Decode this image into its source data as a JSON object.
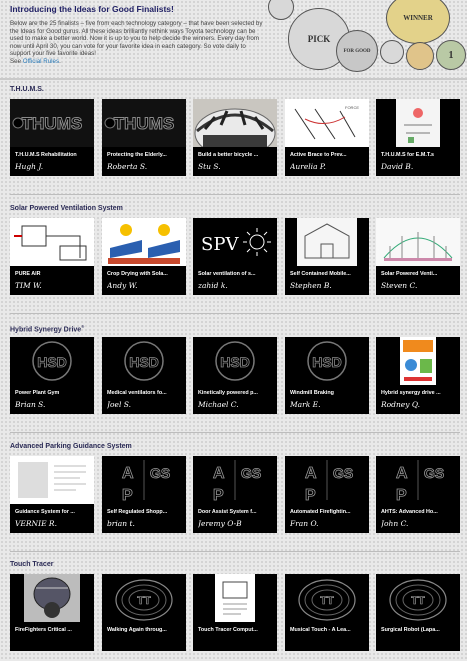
{
  "intro": {
    "title": "Introducing the Ideas for Good Finalists!",
    "body": "Below are the 25 finalists – five from each technology category – that have been selected by the Ideas for Good gurus. All these ideas brilliantly rethink ways Toyota technology can be used to make a better world. Now it is up to you to help decide the winners. Every day from now until April 30, you can vote for your favorite idea in each category. So vote daily to support your five favorite ideas!",
    "see": "See",
    "rules_link": "Official Rules",
    "rules_end": "."
  },
  "coins": [
    "PICK",
    "FOR GOOD",
    "WINNER",
    "1"
  ],
  "categories": [
    {
      "title": "T.H.U.M.S.",
      "cards": [
        {
          "title": "T.H.U.M.S Rehabilitation",
          "author": "Hugh J.",
          "thumb": "thums"
        },
        {
          "title": "Protecting the Elderly...",
          "author": "Roberta S.",
          "thumb": "thums"
        },
        {
          "title": "Build a better bicycle ...",
          "author": "Stu S.",
          "thumb": "helmet"
        },
        {
          "title": "Active Brace to Prev...",
          "author": "Aurelia P.",
          "thumb": "sketch"
        },
        {
          "title": "T.H.U.M.S for E.M.T.s",
          "author": "David B.",
          "thumb": "diagram"
        }
      ]
    },
    {
      "title": "Solar Powered Ventilation System",
      "cards": [
        {
          "title": "PURE AIR",
          "author": "TIM W.",
          "thumb": "flow"
        },
        {
          "title": "Crop Drying with Sola...",
          "author": "Andy W.",
          "thumb": "solar"
        },
        {
          "title": "Solar ventilation of s...",
          "author": "zahid k.",
          "thumb": "spv"
        },
        {
          "title": "Self Contained Mobile...",
          "author": "Stephen B.",
          "thumb": "house"
        },
        {
          "title": "Solar Powered Venti...",
          "author": "Steven C.",
          "thumb": "dome"
        }
      ]
    },
    {
      "title": "Hybrid Synergy Drive",
      "title_sup": "®",
      "cards": [
        {
          "title": "Power Plant Gym",
          "author": "Brian S.",
          "thumb": "hsd"
        },
        {
          "title": "Medical ventilators fo...",
          "author": "Joel S.",
          "thumb": "hsd"
        },
        {
          "title": "Kinetically powered p...",
          "author": "Michael C.",
          "thumb": "hsd"
        },
        {
          "title": "Windmill Braking",
          "author": "Mark E.",
          "thumb": "hsd"
        },
        {
          "title": "Hybrid synergy drive ...",
          "author": "Rodney Q.",
          "thumb": "poster"
        }
      ]
    },
    {
      "title": "Advanced Parking Guidance System",
      "cards": [
        {
          "title": "Guidance System for ...",
          "author": "VERNIE R.",
          "thumb": "doc"
        },
        {
          "title": "Self Regulated Shopp...",
          "author": "brian t.",
          "thumb": "apgs"
        },
        {
          "title": "Door Assist System f...",
          "author": "Jeremy O-B",
          "thumb": "apgs"
        },
        {
          "title": "Automated Firefightin...",
          "author": "Fran O.",
          "thumb": "apgs"
        },
        {
          "title": "AHTS: Advanced Ho...",
          "author": "John C.",
          "thumb": "apgs"
        }
      ]
    },
    {
      "title": "Touch Tracer",
      "cards": [
        {
          "title": "FireFighters Critical ...",
          "author": "",
          "thumb": "mask"
        },
        {
          "title": "Walking Again throug...",
          "author": "",
          "thumb": "tt"
        },
        {
          "title": "Touch Tracer Comput...",
          "author": "",
          "thumb": "ttdoc"
        },
        {
          "title": "Musical Touch - A Lea...",
          "author": "",
          "thumb": "tt"
        },
        {
          "title": "Surgical Robot (Lapa...",
          "author": "",
          "thumb": "tt"
        }
      ]
    }
  ]
}
